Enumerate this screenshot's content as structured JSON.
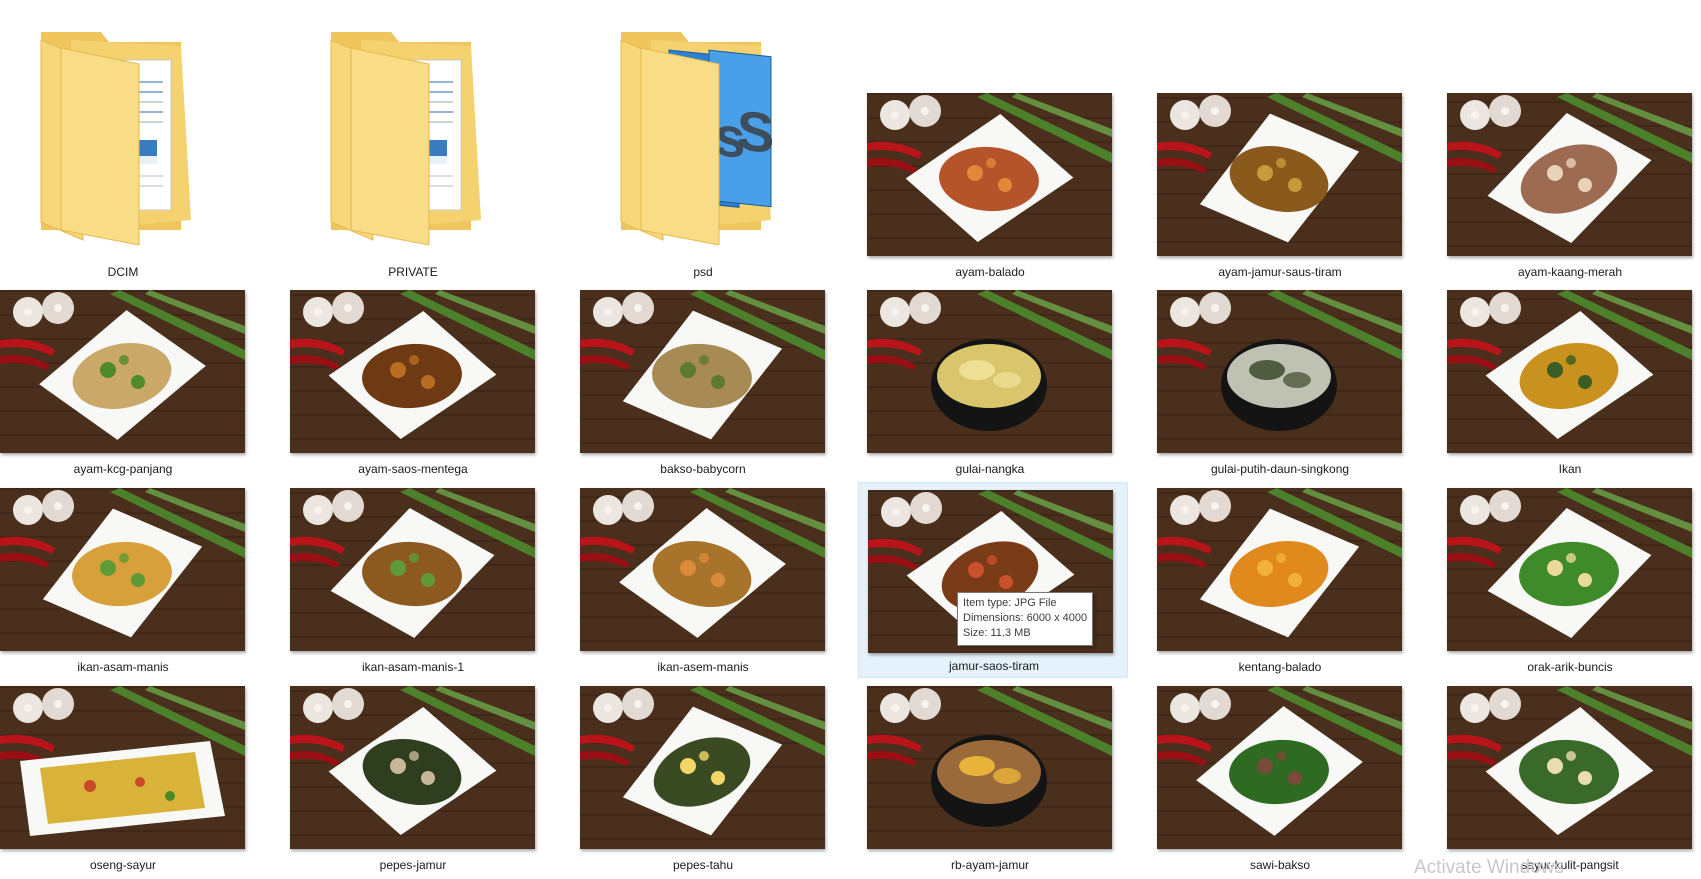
{
  "items": [
    {
      "name": "DCIM",
      "kind": "folder",
      "folder_style": "documents",
      "dish": null
    },
    {
      "name": "PRIVATE",
      "kind": "folder",
      "folder_style": "documents",
      "dish": null
    },
    {
      "name": "psd",
      "kind": "folder",
      "folder_style": "photoshop",
      "dish": null
    },
    {
      "name": "ayam-balado",
      "kind": "image",
      "dish": {
        "plate": "diamond",
        "food": "#b5532a",
        "accent": "#e0893a"
      }
    },
    {
      "name": "ayam-jamur-saus-tiram",
      "kind": "image",
      "dish": {
        "plate": "diamond",
        "food": "#8a5a1c",
        "accent": "#c79a3a"
      }
    },
    {
      "name": "ayam-kaang-merah",
      "kind": "image",
      "dish": {
        "plate": "diamond",
        "food": "#9c6b52",
        "accent": "#e8d2b8"
      }
    },
    {
      "name": "ayam-kcg-panjang",
      "kind": "image",
      "dish": {
        "plate": "diamond",
        "food": "#c9a86a",
        "accent": "#4f8a2c"
      }
    },
    {
      "name": "ayam-saos-mentega",
      "kind": "image",
      "dish": {
        "plate": "diamond",
        "food": "#6e3a14",
        "accent": "#b86d22"
      }
    },
    {
      "name": "bakso-babycorn",
      "kind": "image",
      "dish": {
        "plate": "diamond",
        "food": "#a88a55",
        "accent": "#5e7a2e"
      }
    },
    {
      "name": "gulai-nangka",
      "kind": "image",
      "dish": {
        "plate": "bowl",
        "food": "#d9c56b",
        "accent": "#f0e39a"
      }
    },
    {
      "name": "gulai-putih-daun-singkong",
      "kind": "image",
      "dish": {
        "plate": "bowl",
        "food": "#bfc2b2",
        "accent": "#3c4a2a"
      }
    },
    {
      "name": "Ikan",
      "kind": "image",
      "dish": {
        "plate": "diamond",
        "food": "#c9921e",
        "accent": "#3a5e25"
      }
    },
    {
      "name": "ikan-asam-manis",
      "kind": "image",
      "dish": {
        "plate": "diamond",
        "food": "#d7a03a",
        "accent": "#5e9a36"
      }
    },
    {
      "name": "ikan-asam-manis-1",
      "kind": "image",
      "dish": {
        "plate": "diamond",
        "food": "#8c5a20",
        "accent": "#5e9a36"
      }
    },
    {
      "name": "ikan-asem-manis",
      "kind": "image",
      "dish": {
        "plate": "diamond",
        "food": "#a8732a",
        "accent": "#d98a3a"
      }
    },
    {
      "name": "jamur-saos-tiram",
      "kind": "image",
      "dish": {
        "plate": "diamond",
        "food": "#7a3c18",
        "accent": "#c9502a"
      }
    },
    {
      "name": "kentang-balado",
      "kind": "image",
      "dish": {
        "plate": "diamond",
        "food": "#e08a1e",
        "accent": "#f2b13a"
      }
    },
    {
      "name": "orak-arik-buncis",
      "kind": "image",
      "dish": {
        "plate": "diamond",
        "food": "#3f8a2a",
        "accent": "#e9d99a"
      }
    },
    {
      "name": "oseng-sayur",
      "kind": "image",
      "dish": {
        "plate": "rect",
        "food": "#d9b23a",
        "accent": "#c94a2a"
      }
    },
    {
      "name": "pepes-jamur",
      "kind": "image",
      "dish": {
        "plate": "diamond",
        "food": "#2f3e1e",
        "accent": "#c9b79a"
      }
    },
    {
      "name": "pepes-tahu",
      "kind": "image",
      "dish": {
        "plate": "diamond",
        "food": "#3a4a22",
        "accent": "#f2d66a"
      }
    },
    {
      "name": "rb-ayam-jamur",
      "kind": "image",
      "dish": {
        "plate": "bowl",
        "food": "#9a6a3a",
        "accent": "#f5c13a"
      }
    },
    {
      "name": "sawi-bakso",
      "kind": "image",
      "dish": {
        "plate": "diamond",
        "food": "#2e6a22",
        "accent": "#7a4a3a"
      }
    },
    {
      "name": "sayur-kulit-pangsit",
      "kind": "image",
      "dish": {
        "plate": "diamond",
        "food": "#3a6a2a",
        "accent": "#e8dcb0"
      }
    }
  ],
  "selected_item": "jamur-saos-tiram",
  "tooltip": {
    "type_line": "Item type: JPG File",
    "dimensions_line": "Dimensions: 6000 x 4000",
    "size_line": "Size: 11.3 MB"
  },
  "watermark": "Activate Windows",
  "colors": {
    "wood": "#4a2f1d",
    "wood_dark": "#3a2416",
    "plate": "#f8f8f6",
    "garlic": "#ece6e0",
    "chili": "#b8141a",
    "leek": "#4e8a2e",
    "folder": "#f7d77a",
    "selection": "#e5f1fb"
  }
}
